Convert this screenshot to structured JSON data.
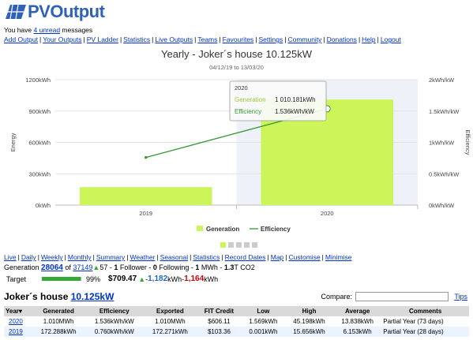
{
  "brand": {
    "logo_pv": "PV",
    "logo_out": "Output"
  },
  "messages": {
    "prefix": "You have ",
    "link": "4 unread",
    "suffix": " messages"
  },
  "nav": [
    "Add Output",
    "Your Outputs",
    "PV Ladder",
    "Statistics",
    "Live Outputs",
    "Teams",
    "Favourites",
    "Settings",
    "Community",
    "Donations",
    "Help",
    "Logout"
  ],
  "chart": {
    "title": "Yearly - Joker´s house 10.125kW",
    "subtitle": "04/12/19 to 13/03/20",
    "left_axis_label": "Energy",
    "right_axis_label": "Efficiency",
    "left_ticks": [
      "0kWh",
      "300kWh",
      "600kWh",
      "900kWh",
      "1200kWh"
    ],
    "right_ticks": [
      "0kWh/kW",
      "0.5kWh/kW",
      "1kWh/kW",
      "1.5kWh/kW",
      "2kWh/kW"
    ],
    "legend": {
      "generation": "Generation",
      "efficiency": "Efficiency"
    },
    "tooltip": {
      "header": "2020",
      "gen_label": "Generation",
      "gen_value": "1 010.181kWh",
      "eff_label": "Efficiency",
      "eff_value": "1.536kWh/kW"
    },
    "colors": {
      "bar": "#ccf55a",
      "line": "#339933",
      "highlight": "#eef2f8"
    }
  },
  "chart_data": {
    "type": "bar",
    "categories": [
      "2019",
      "2020"
    ],
    "series": [
      {
        "name": "Generation",
        "type": "bar",
        "axis": "left",
        "values": [
          172.288,
          1010.181
        ]
      },
      {
        "name": "Efficiency",
        "type": "line",
        "axis": "right",
        "values": [
          0.76,
          1.536
        ]
      }
    ],
    "ylim_left": [
      0,
      1200
    ],
    "ylim_right": [
      0,
      2
    ],
    "grid": true,
    "legend_position": "bottom-center"
  },
  "pager": {
    "pages": 5,
    "active": 0
  },
  "sublinks": [
    "Live",
    "Daily",
    "Weekly",
    "Monthly",
    "Summary",
    "Weather",
    "Seasonal",
    "Statistics",
    "Record Dates",
    "Map",
    "Customise",
    "Minimise"
  ],
  "summary": {
    "gen_label": "Generation ",
    "gen_rank": "28064",
    "of_label": " of ",
    "gen_total": "37149",
    "up_arrow": "▲",
    "up_count": "57",
    "followers": "1",
    "followers_label": " Follower - ",
    "following": "0",
    "following_label": " Following - ",
    "mwh": "1",
    "mwh_label": " MWh - ",
    "co2": "1.3",
    "co2_label": "T CO2"
  },
  "target": {
    "label": "Target",
    "percent": 99,
    "percent_text": "99%",
    "value": "$709.47",
    "value_arrow": "▲",
    "sep1": " - ",
    "down_value": "1,182",
    "unit": "kWh",
    "sep2": " - ",
    "neg_value": "1,164",
    "unit2": "kWh"
  },
  "system": {
    "name": "Joker´s house ",
    "size_link": "10.125kW",
    "compare_label": "Compare:",
    "compare_value": "",
    "tips": "Tips"
  },
  "table": {
    "headers": [
      "Year",
      "Generated",
      "Efficiency",
      "Exported",
      "FIT Credit",
      "Low",
      "High",
      "Average",
      "Comments"
    ],
    "sort_mark": "▾",
    "rows": [
      [
        "2020",
        "1.010MWh",
        "1.536kWh/kW",
        "1.010MWh",
        "$606.11",
        "1.569kWh",
        "45.198kWh",
        "13.838kWh",
        "Partial Year (73 days)"
      ],
      [
        "2019",
        "172.288kWh",
        "0.760kWh/kW",
        "172.271kWh",
        "$103.36",
        "0.001kWh",
        "15.656kWh",
        "6.153kWh",
        "Partial Year (28 days)"
      ]
    ]
  }
}
